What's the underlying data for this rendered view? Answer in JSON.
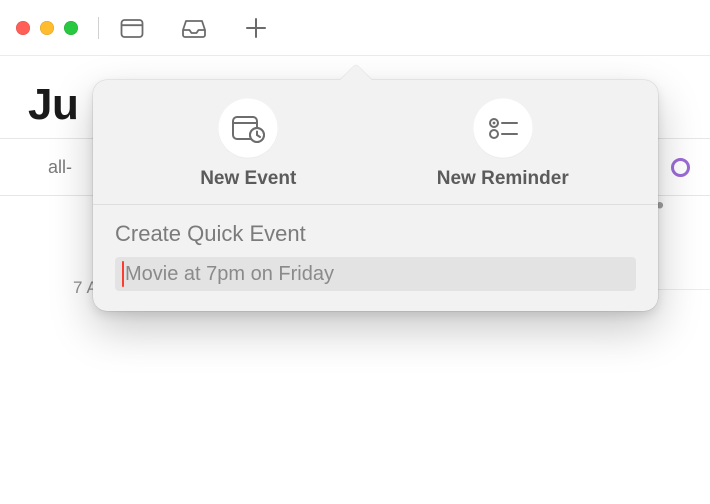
{
  "toolbar": {
    "calendars_button": "Calendars toolbar icon",
    "inbox_button": "Inbox toolbar icon",
    "add_button": "Add toolbar icon"
  },
  "month_header": {
    "visible_text": "Ju"
  },
  "timeline": {
    "all_day_label": "all-",
    "slots": [
      {
        "hour": "7",
        "ampm": "AM"
      }
    ]
  },
  "popover": {
    "tabs": {
      "new_event_label": "New Event",
      "new_reminder_label": "New Reminder"
    },
    "quick_event": {
      "heading": "Create Quick Event",
      "placeholder": "Movie at 7pm on Friday",
      "value": ""
    }
  },
  "icons": {
    "calendar": "calendar-icon",
    "inbox": "inbox-icon",
    "plus": "plus-icon",
    "event": "calendar-with-clock-icon",
    "reminder": "reminder-list-icon"
  },
  "colors": {
    "accent_red_caret": "#ff3b30",
    "event_ring_purple": "#9b6bd6"
  }
}
